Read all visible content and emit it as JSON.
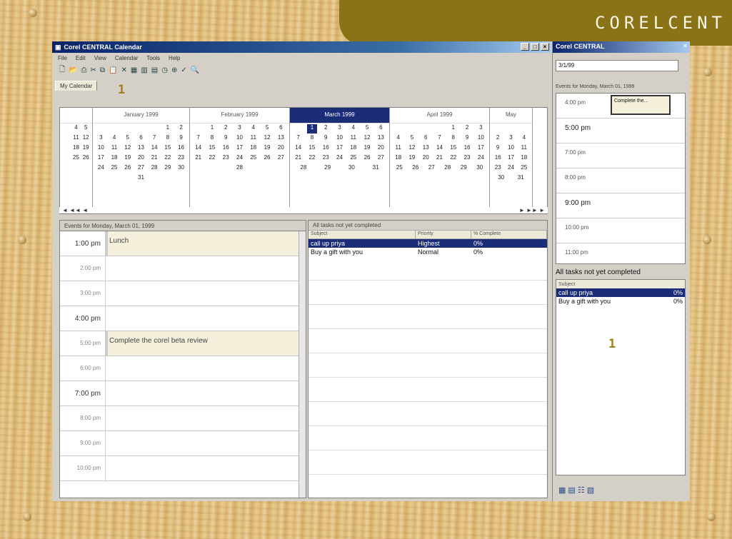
{
  "banner": {
    "text": "CORELCENT"
  },
  "main": {
    "title": "Corel CENTRAL Calendar",
    "menus": [
      "File",
      "Edit",
      "View",
      "Calendar",
      "Tools",
      "Help"
    ],
    "tab": "My Calendar",
    "mark1": "1",
    "months": [
      {
        "name": "",
        "rows": [
          [
            "",
            "4",
            "5"
          ],
          [
            "",
            "11",
            "12"
          ],
          [
            "",
            "18",
            "19"
          ],
          [
            "",
            "25",
            "26"
          ]
        ]
      },
      {
        "name": "January 1999",
        "rows": [
          [
            "",
            "",
            "",
            "",
            "",
            "1",
            "2"
          ],
          [
            "3",
            "4",
            "5",
            "6",
            "7",
            "8",
            "9"
          ],
          [
            "10",
            "11",
            "12",
            "13",
            "14",
            "15",
            "16"
          ],
          [
            "17",
            "18",
            "19",
            "20",
            "21",
            "22",
            "23"
          ],
          [
            "24",
            "25",
            "26",
            "27",
            "28",
            "29",
            "30"
          ],
          [
            "31"
          ]
        ]
      },
      {
        "name": "February 1999",
        "rows": [
          [
            "",
            "1",
            "2",
            "3",
            "4",
            "5",
            "6"
          ],
          [
            "7",
            "8",
            "9",
            "10",
            "11",
            "12",
            "13"
          ],
          [
            "14",
            "15",
            "16",
            "17",
            "18",
            "19",
            "20"
          ],
          [
            "21",
            "22",
            "23",
            "24",
            "25",
            "26",
            "27"
          ],
          [
            "28"
          ]
        ]
      },
      {
        "name": "March 1999",
        "rows": [
          [
            "",
            "1",
            "2",
            "3",
            "4",
            "5",
            "6"
          ],
          [
            "7",
            "8",
            "9",
            "10",
            "11",
            "12",
            "13"
          ],
          [
            "14",
            "15",
            "16",
            "17",
            "18",
            "19",
            "20"
          ],
          [
            "21",
            "22",
            "23",
            "24",
            "25",
            "26",
            "27"
          ],
          [
            "28",
            "29",
            "30",
            "31"
          ]
        ]
      },
      {
        "name": "April 1999",
        "rows": [
          [
            "",
            "",
            "",
            "",
            "1",
            "2",
            "3"
          ],
          [
            "4",
            "5",
            "6",
            "7",
            "8",
            "9",
            "10"
          ],
          [
            "11",
            "12",
            "13",
            "14",
            "15",
            "16",
            "17"
          ],
          [
            "18",
            "19",
            "20",
            "21",
            "22",
            "23",
            "24"
          ],
          [
            "25",
            "26",
            "27",
            "28",
            "29",
            "30"
          ]
        ]
      },
      {
        "name": "May",
        "rows": [
          [
            "",
            "",
            "",
            ""
          ],
          [
            "2",
            "3",
            "4"
          ],
          [
            "9",
            "10",
            "11"
          ],
          [
            "16",
            "17",
            "18"
          ],
          [
            "23",
            "24",
            "25"
          ],
          [
            "30",
            "31"
          ]
        ]
      }
    ],
    "day_header": "Events for Monday, March 01, 1999",
    "slots": [
      {
        "time": "1:00 pm",
        "text": "Lunch",
        "filled": true,
        "big": true
      },
      {
        "time": "2:00 pm",
        "text": "",
        "filled": false,
        "big": false
      },
      {
        "time": "3:00 pm",
        "text": "",
        "filled": false,
        "big": false
      },
      {
        "time": "4:00 pm",
        "text": "",
        "filled": false,
        "big": true
      },
      {
        "time": "5:00 pm",
        "text": "Complete the corel beta review",
        "filled": true,
        "big": false
      },
      {
        "time": "6:00 pm",
        "text": "",
        "filled": false,
        "big": false
      },
      {
        "time": "7:00 pm",
        "text": "",
        "filled": false,
        "big": true
      },
      {
        "time": "8:00 pm",
        "text": "",
        "filled": false,
        "big": false
      },
      {
        "time": "9:00 pm",
        "text": "",
        "filled": false,
        "big": false
      },
      {
        "time": "10:00 pm",
        "text": "",
        "filled": false,
        "big": false
      }
    ],
    "tasks": {
      "header": "All tasks not yet completed",
      "columns": [
        "Subject",
        "Priority",
        "% Complete"
      ],
      "rows": [
        {
          "subject": "call up priya",
          "priority": "Highest",
          "pct": "0%"
        },
        {
          "subject": "Buy a gift with you",
          "priority": "Normal",
          "pct": "0%"
        }
      ]
    }
  },
  "side": {
    "title": "Corel CENTRAL",
    "date": "3/1/99",
    "day_header": "Events for Monday, March 01, 1999",
    "slots": [
      {
        "time": "4:00 pm",
        "big": false
      },
      {
        "time": "5:00 pm",
        "big": true
      },
      {
        "time": "7:00 pm",
        "big": false
      },
      {
        "time": "8:00 pm",
        "big": false
      },
      {
        "time": "9:00 pm",
        "big": true
      },
      {
        "time": "10:00 pm",
        "big": false
      },
      {
        "time": "11:00 pm",
        "big": false
      }
    ],
    "box_text": "Complete the...",
    "tasks_header": "All tasks not yet completed",
    "tasks_col": "Subject",
    "tasks": [
      {
        "subject": "call up priya",
        "pct": "0%"
      },
      {
        "subject": "Buy a gift with you",
        "pct": "0%"
      }
    ],
    "mark2": "1"
  }
}
